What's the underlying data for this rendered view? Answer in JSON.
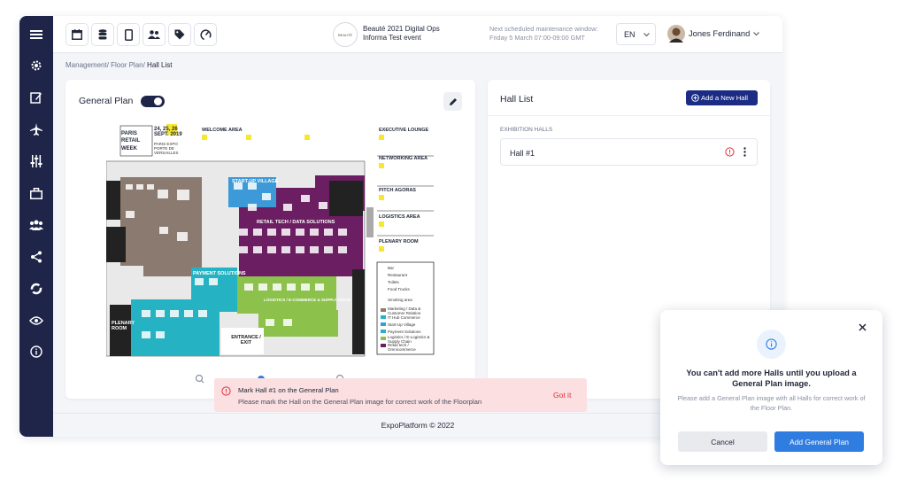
{
  "topbar": {
    "event_badge": "BEAUTÉ",
    "event_title": "Beauté 2021 Digital Ops",
    "event_subtitle": "Informa Test event",
    "maintenance_label": "Next scheduled maintenance window:",
    "maintenance_time": "Friday 5 March 07:00-09:00 GMT",
    "language": "EN",
    "user_name": "Jones Ferdinand"
  },
  "breadcrumb": {
    "part1": "Management/ ",
    "part2": "Floor Plan/ ",
    "current": "Hall List"
  },
  "general_plan": {
    "label": "General Plan",
    "toggle_on": true
  },
  "floorplan": {
    "dates": "24, 25, 26 SEPT. 2019",
    "event_lines": [
      "PARIS",
      "RETAIL",
      "WEEK"
    ],
    "venue": "PARIS EXPO PORTE DE VERSAILLES",
    "legend_headers": [
      "WELCOME AREA",
      "EXECUTIVE LOUNGE",
      "NETWORKING AREA",
      "PITCH AGORAS",
      "LOGISTICS AREA",
      "PLENARY ROOM"
    ],
    "zone_labels": [
      "START-UP VILLAGE",
      "PAYMENT SOLUTIONS",
      "RETAIL TECH / DATA SOLUTIONS",
      "ENTRANCE / EXIT",
      "PLENARY ROOM",
      "LOGISTICS / E-COMMERCE & SUPPLY CHAIN"
    ],
    "legend_items": [
      "Bar",
      "Restaurant",
      "Toilets",
      "Food Trucks",
      "Smoking area",
      "Marketing / Data & Customer Relation",
      "IT Hub Commerce",
      "Start-Up Village",
      "Payment Solutions",
      "Logistics / E-Logistics & Supply Chain",
      "Retail tech / Omnicommerce"
    ]
  },
  "hall_list": {
    "title": "Hall List",
    "add_button": "Add a New Hall",
    "section_label": "EXHIBITION HALLS",
    "halls": [
      "Hall #1"
    ]
  },
  "toast": {
    "title": "Mark Hall #1 on the General Plan",
    "message": "Please mark the Hall on the General Plan image for correct work of the Floorplan",
    "action": "Got it"
  },
  "footer": "ExpoPlatform © 2022",
  "modal": {
    "title": "You can't add more Halls until you upload a General Plan image.",
    "body": "Please add a General Plan image with all Halls for correct work of the Floor Plan.",
    "cancel": "Cancel",
    "confirm": "Add General Plan"
  },
  "colors": {
    "sidebar": "#1e2549",
    "primary": "#1c2c84",
    "accent_blue": "#2f7de1",
    "toggle": "#1e2549",
    "error": "#e0313b",
    "zone_brown": "#8a7a6f",
    "zone_purple": "#6c1e63",
    "zone_teal": "#25b3c4",
    "zone_green": "#8cc14b",
    "zone_blue": "#3b9ad7"
  }
}
